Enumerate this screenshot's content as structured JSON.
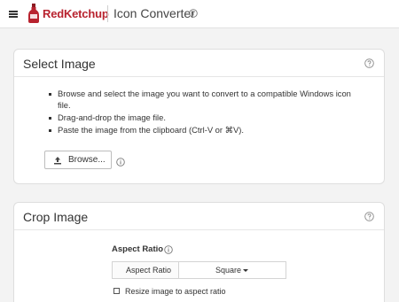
{
  "header": {
    "brand": "RedKetchup",
    "title": "Icon Converter",
    "icons": {
      "menu": "hamburger-menu-icon",
      "logo": "ketchup-bottle-logo",
      "info": "info-circle-icon"
    }
  },
  "select_image": {
    "title": "Select Image",
    "bullets": [
      "Browse and select the image you want to convert to a compatible Windows icon file.",
      "Drag-and-drop the image file.",
      "Paste the image from the clipboard (Ctrl-V or ⌘V)."
    ],
    "browse_label": "Browse...",
    "icons": {
      "help": "question-circle-icon",
      "upload": "upload-icon",
      "info": "info-circle-icon"
    }
  },
  "crop_image": {
    "title": "Crop Image",
    "aspect_ratio_label": "Aspect Ratio",
    "aspect_ratio_field_label": "Aspect Ratio",
    "aspect_ratio_value": "Square",
    "resize_label": "Resize image to aspect ratio",
    "resize_checked": false,
    "icons": {
      "help": "question-circle-icon",
      "info": "info-circle-icon",
      "dropdown": "caret-down-icon"
    }
  },
  "colors": {
    "brand": "#b8232f",
    "background": "#f3f3f3",
    "card": "#ffffff",
    "border": "#dedede"
  }
}
